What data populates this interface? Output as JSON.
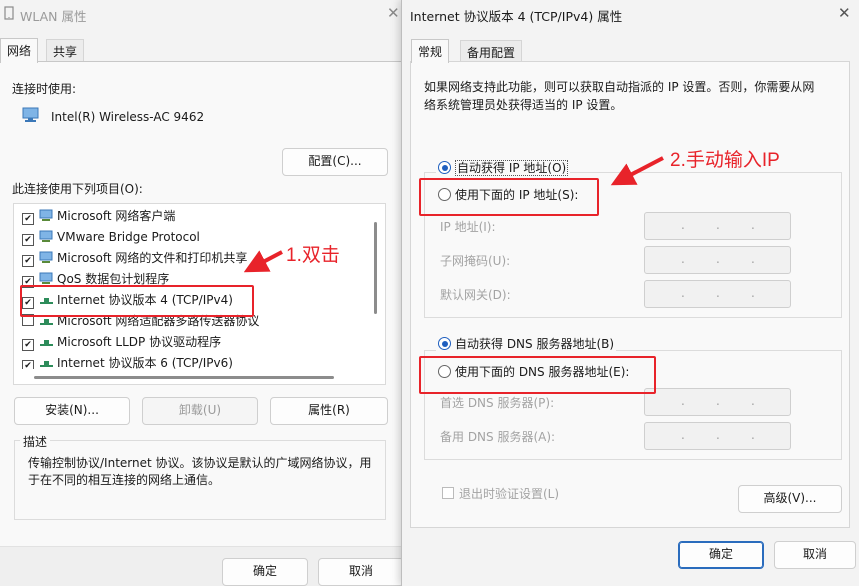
{
  "wlan": {
    "title": "WLAN 属性",
    "tabs": [
      "网络",
      "共享"
    ],
    "connect_using_label": "连接时使用:",
    "adapter_name": "Intel(R) Wireless-AC 9462",
    "configure_button": "配置(C)...",
    "items_label": "此连接使用下列项目(O):",
    "items": [
      {
        "label": "Microsoft 网络客户端",
        "checked": true
      },
      {
        "label": "VMware Bridge Protocol",
        "checked": true
      },
      {
        "label": "Microsoft 网络的文件和打印机共享",
        "checked": true
      },
      {
        "label": "QoS 数据包计划程序",
        "checked": true
      },
      {
        "label": "Internet 协议版本 4 (TCP/IPv4)",
        "checked": true
      },
      {
        "label": "Microsoft 网络适配器多路传送器协议",
        "checked": false
      },
      {
        "label": "Microsoft LLDP 协议驱动程序",
        "checked": true
      },
      {
        "label": "Internet 协议版本 6 (TCP/IPv6)",
        "checked": true
      }
    ],
    "install_button": "安装(N)...",
    "uninstall_button": "卸载(U)",
    "properties_button": "属性(R)",
    "description_label": "描述",
    "description_text": "传输控制协议/Internet 协议。该协议是默认的广域网络协议，用于在不同的相互连接的网络上通信。",
    "ok_button": "确定",
    "cancel_button": "取消"
  },
  "ipv4": {
    "title": "Internet 协议版本 4 (TCP/IPv4) 属性",
    "tabs": [
      "常规",
      "备用配置"
    ],
    "intro": "如果网络支持此功能，则可以获取自动指派的 IP 设置。否则，你需要从网络系统管理员处获得适当的 IP 设置。",
    "auto_ip": "自动获得 IP 地址(O)",
    "manual_ip": "使用下面的 IP 地址(S):",
    "ip_address_label": "IP 地址(I):",
    "subnet_label": "子网掩码(U):",
    "gateway_label": "默认网关(D):",
    "auto_dns": "自动获得 DNS 服务器地址(B)",
    "manual_dns": "使用下面的 DNS 服务器地址(E):",
    "preferred_dns_label": "首选 DNS 服务器(P):",
    "alternate_dns_label": "备用 DNS 服务器(A):",
    "validate_label": "退出时验证设置(L)",
    "advanced_button": "高级(V)...",
    "ok_button": "确定",
    "cancel_button": "取消"
  },
  "annotations": {
    "step1": "1.双击",
    "step2": "2.手动输入IP",
    "color": "#e8232a"
  }
}
